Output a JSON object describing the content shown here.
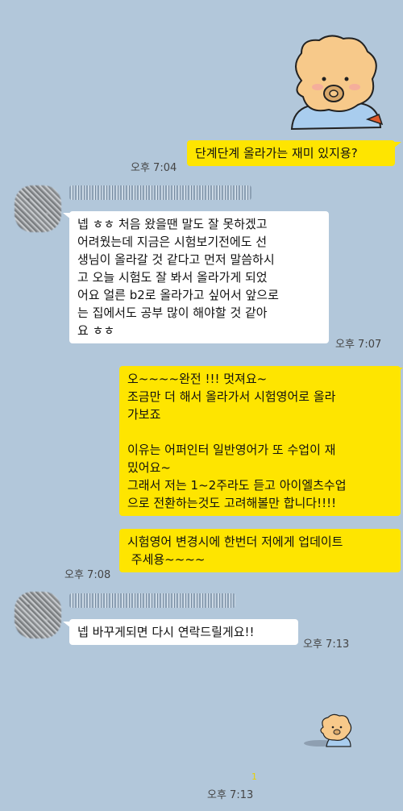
{
  "messages": [
    {
      "text": "단계단계 올라가는 재미 있지용?",
      "time": "오후 7:04"
    },
    {
      "text": "넵 ㅎㅎ 처음 왔을땐 말도 잘 못하겠고\n어려웠는데 지금은 시험보기전에도 선\n생님이 올라갈 것 같다고 먼저 말씀하시\n고 오늘 시험도 잘 봐서 올라가게 되었\n어요 얼른 b2로 올라가고 싶어서 앞으로\n는 집에서도 공부 많이 해야할 것 같아\n요 ㅎㅎ",
      "time": "오후 7:07"
    },
    {
      "text": "오~~~~완전 !!! 멋져요~\n조금만 더 해서 올라가서 시험영어로 올라\n가보죠\n\n이유는 어퍼인터 일반영어가 또 수업이 재\n밌어요~\n그래서 저는 1~2주라도 듣고 아이엘츠수업\n으로 전환하는것도 고려해볼만 합니다!!!!"
    },
    {
      "text": "시험영어 변경시에 한번더 저에게 업데이트\n 주세용~~~~",
      "time": "오후 7:08"
    },
    {
      "text": "넵 바꾸게되면 다시 연락드릴게요!!",
      "time": "오후 7:13"
    }
  ],
  "sticker_unread": "1",
  "sticker_time": "오후 7:13",
  "icons": {
    "sticker_large": "bear-sticker-icon",
    "sticker_small": "bear-sticker-small-icon",
    "avatar": "blurred-profile-avatar"
  }
}
